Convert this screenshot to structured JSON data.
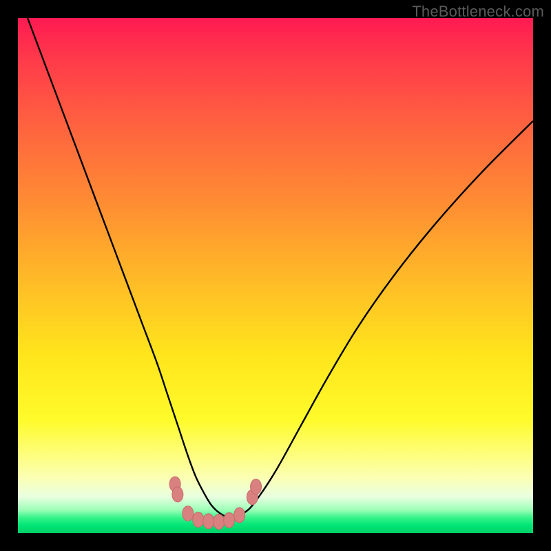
{
  "watermark": "TheBottleneck.com",
  "colors": {
    "frame": "#000000",
    "curve_stroke": "#000000",
    "marker_fill": "#d98080",
    "marker_stroke": "#c86a6a"
  },
  "chart_data": {
    "type": "line",
    "title": "",
    "xlabel": "",
    "ylabel": "",
    "xlim": [
      0,
      100
    ],
    "ylim": [
      0,
      100
    ],
    "grid": false,
    "series": [
      {
        "name": "bottleneck-curve",
        "x": [
          0,
          3,
          6,
          9,
          12,
          15,
          18,
          21,
          24,
          27,
          29,
          31,
          33,
          34.5,
          36,
          37.5,
          39,
          40.5,
          42,
          44,
          46,
          50,
          55,
          60,
          66,
          73,
          81,
          90,
          100
        ],
        "y": [
          105,
          97,
          89,
          81,
          73,
          65,
          57,
          49,
          41,
          33,
          27,
          21,
          15,
          11,
          8,
          5.5,
          4,
          3.2,
          3.2,
          4,
          6,
          12,
          21,
          30,
          40,
          50,
          60,
          70,
          80
        ]
      }
    ],
    "markers": [
      {
        "x": 30.5,
        "y": 9.5
      },
      {
        "x": 31,
        "y": 7.5
      },
      {
        "x": 33,
        "y": 3.8
      },
      {
        "x": 35,
        "y": 2.6
      },
      {
        "x": 37,
        "y": 2.3
      },
      {
        "x": 39,
        "y": 2.2
      },
      {
        "x": 41,
        "y": 2.5
      },
      {
        "x": 43,
        "y": 3.5
      },
      {
        "x": 45.5,
        "y": 7.0
      },
      {
        "x": 46.2,
        "y": 9.0
      }
    ]
  }
}
